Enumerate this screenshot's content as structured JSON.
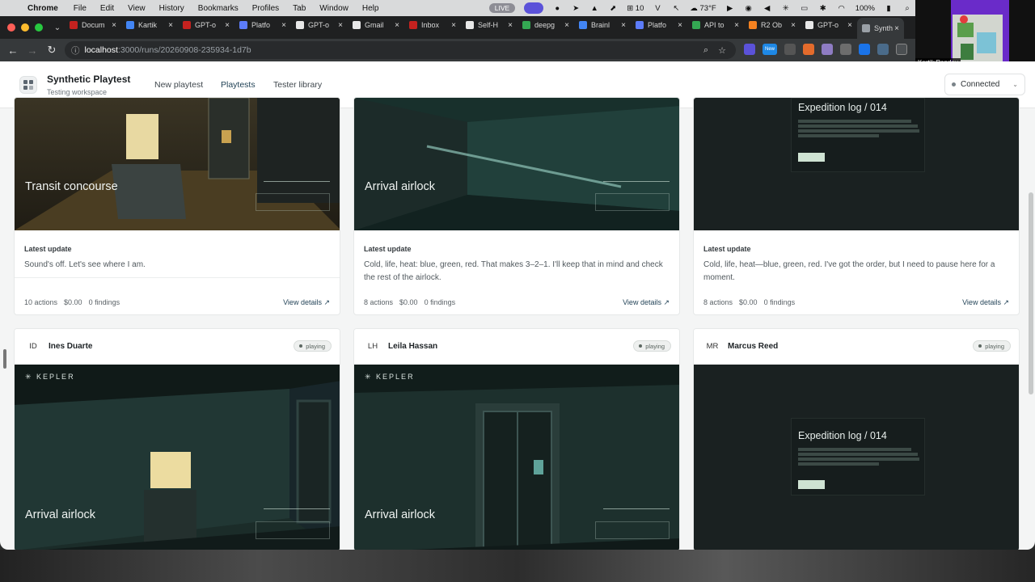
{
  "menubar": {
    "app": "Chrome",
    "items": [
      "File",
      "Edit",
      "View",
      "History",
      "Bookmarks",
      "Profiles",
      "Tab",
      "Window",
      "Help"
    ],
    "live": "LIVE",
    "calendar_count": "10",
    "weather": "73°F",
    "battery": "100%"
  },
  "tabs": [
    {
      "label": "Docum",
      "color": "#c5221f"
    },
    {
      "label": "Kartik",
      "color": "#4285f4"
    },
    {
      "label": "GPT-o",
      "color": "#c5221f"
    },
    {
      "label": "Platfo",
      "color": "#5c7cfa"
    },
    {
      "label": "GPT-o",
      "color": "#e8e8e8"
    },
    {
      "label": "Gmail",
      "color": "#e8e8e8"
    },
    {
      "label": "Inbox",
      "color": "#c5221f"
    },
    {
      "label": "Self-H",
      "color": "#e8e8e8"
    },
    {
      "label": "deepg",
      "color": "#34a853"
    },
    {
      "label": "Brainl",
      "color": "#4285f4"
    },
    {
      "label": "Platfo",
      "color": "#5c7cfa"
    },
    {
      "label": "API to",
      "color": "#34a853"
    },
    {
      "label": "R2 Ob",
      "color": "#f48120"
    },
    {
      "label": "GPT-o",
      "color": "#e8e8e8"
    },
    {
      "label": "Synth",
      "color": "#9aa0a6"
    }
  ],
  "address": {
    "host": "localhost",
    "path": ":3000/runs/20260908-235934-1d7b"
  },
  "webcam": {
    "name": "Kartik Pandey"
  },
  "header": {
    "brand_title": "Synthetic Playtest",
    "brand_subtitle": "Testing workspace",
    "nav": [
      "New playtest",
      "Playtests",
      "Tester library"
    ],
    "status": "Connected"
  },
  "row1": [
    {
      "scene_title": "Transit concourse",
      "update_label": "Latest update",
      "update_text": "Sound's off. Let's see where I am.",
      "actions": "10 actions",
      "cost": "$0.00",
      "findings": "0 findings",
      "link": "View details ↗"
    },
    {
      "scene_title": "Arrival airlock",
      "update_label": "Latest update",
      "update_text": "Cold, life, heat: blue, green, red. That makes 3–2–1. I'll keep that in mind and check the rest of the airlock.",
      "actions": "8 actions",
      "cost": "$0.00",
      "findings": "0 findings",
      "link": "View details ↗"
    },
    {
      "log_title": "Expedition log / 014",
      "update_label": "Latest update",
      "update_text": "Cold, life, heat—blue, green, red. I've got the order, but I need to pause here for a moment.",
      "actions": "8 actions",
      "cost": "$0.00",
      "findings": "0 findings",
      "link": "View details ↗"
    }
  ],
  "row2": [
    {
      "initials": "ID",
      "name": "Ines Duarte",
      "status": "playing",
      "scene_title": "Arrival airlock",
      "logo": "KEPLER"
    },
    {
      "initials": "LH",
      "name": "Leila Hassan",
      "status": "playing",
      "scene_title": "Arrival airlock",
      "logo": "KEPLER"
    },
    {
      "initials": "MR",
      "name": "Marcus Reed",
      "status": "playing",
      "log_title": "Expedition log / 014"
    }
  ]
}
